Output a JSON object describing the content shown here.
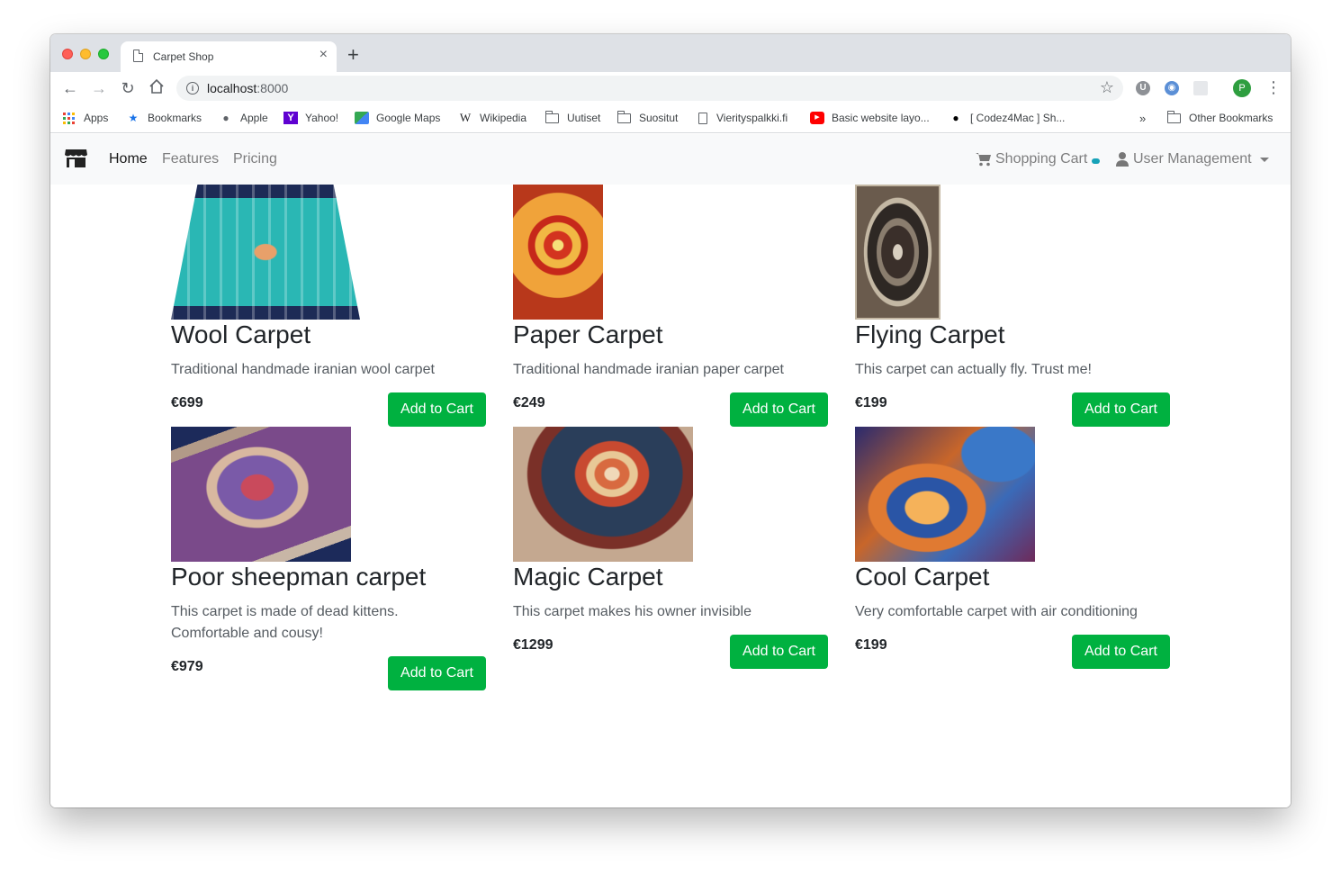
{
  "browser": {
    "tab_title": "Carpet Shop",
    "tab_close": "×",
    "new_tab": "+",
    "url_host": "localhost",
    "url_port": ":8000",
    "profile_initial": "P",
    "bookmarks": [
      {
        "label": "Apps",
        "icon": "apps-icon"
      },
      {
        "label": "Bookmarks",
        "icon": "star-icon"
      },
      {
        "label": "Apple",
        "icon": "apple-icon"
      },
      {
        "label": "Yahoo!",
        "icon": "yahoo-icon"
      },
      {
        "label": "Google Maps",
        "icon": "maps-icon"
      },
      {
        "label": "Wikipedia",
        "icon": "wikipedia-icon"
      },
      {
        "label": "Uutiset",
        "icon": "folder-icon"
      },
      {
        "label": "Suositut",
        "icon": "folder-icon"
      },
      {
        "label": "Vierityspalkki.fi",
        "icon": "document-icon"
      },
      {
        "label": "Basic website layo...",
        "icon": "youtube-icon"
      },
      {
        "label": "[ Codez4Mac ] Sh...",
        "icon": "apple-icon"
      }
    ],
    "bookmarks_overflow": "»",
    "other_bookmarks": "Other Bookmarks"
  },
  "navbar": {
    "links": [
      "Home",
      "Features",
      "Pricing"
    ],
    "cart_label": "Shopping Cart",
    "user_label": "User Management"
  },
  "products": [
    {
      "name": "Wool Carpet",
      "description": "Traditional handmade iranian wool carpet",
      "price": "€699",
      "button": "Add to Cart"
    },
    {
      "name": "Paper Carpet",
      "description": "Traditional handmade iranian paper carpet",
      "price": "€249",
      "button": "Add to Cart"
    },
    {
      "name": "Flying Carpet",
      "description": "This carpet can actually fly. Trust me!",
      "price": "€199",
      "button": "Add to Cart"
    },
    {
      "name": "Poor sheepman carpet",
      "description": "This carpet is made of dead kittens. Comfortable and cousy!",
      "price": "€979",
      "button": "Add to Cart"
    },
    {
      "name": "Magic Carpet",
      "description": "This carpet makes his owner invisible",
      "price": "€1299",
      "button": "Add to Cart"
    },
    {
      "name": "Cool Carpet",
      "description": "Very comfortable carpet with air conditioning",
      "price": "€199",
      "button": "Add to Cart"
    }
  ],
  "colors": {
    "add_to_cart": "#00b140",
    "cart_badge": "#17a2b8",
    "navbar_bg": "#f8f9fa"
  }
}
